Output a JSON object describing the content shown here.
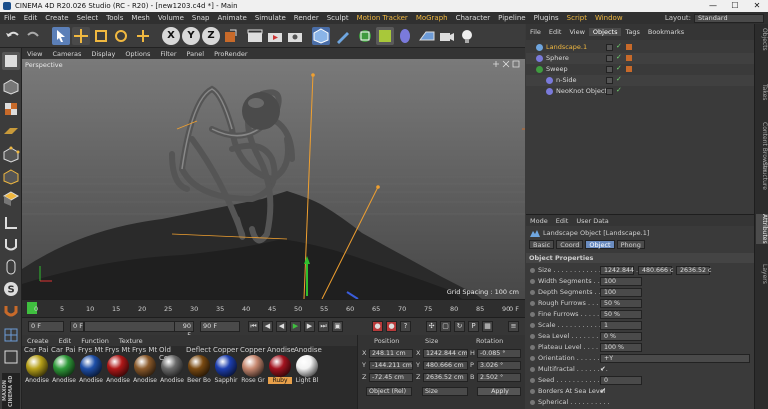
{
  "window": {
    "title": "CINEMA 4D R20.026 Studio (RC - R20) - [new1203.c4d *] - Main",
    "min": "—",
    "max": "☐",
    "close": "✕"
  },
  "menubar": {
    "items": [
      "File",
      "Edit",
      "Create",
      "Select",
      "Tools",
      "Mesh",
      "Volume",
      "Snap",
      "Animate",
      "Simulate",
      "Render",
      "Sculpt",
      "Motion Tracker",
      "MoGraph",
      "Character",
      "Pipeline",
      "Plugins",
      "Script",
      "Window"
    ],
    "layout_label": "Layout:",
    "layout_value": "Standard"
  },
  "toolbar": {
    "axis_x": "X",
    "axis_y": "Y",
    "axis_z": "Z"
  },
  "viewport": {
    "menu": [
      "View",
      "Cameras",
      "Display",
      "Options",
      "Filter",
      "Panel",
      "ProRender"
    ],
    "camera_label": "Perspective",
    "grid_spacing": "Grid Spacing : 100 cm"
  },
  "timeline": {
    "ticks": [
      "0",
      "5",
      "10",
      "15",
      "20",
      "25",
      "30",
      "35",
      "40",
      "45",
      "50",
      "55",
      "60",
      "65",
      "70",
      "75",
      "80",
      "85",
      "90"
    ],
    "end_label": "0 F"
  },
  "transport": {
    "current_frame": "0 F",
    "start_frame": "0 F",
    "end_frame": "90 F",
    "end_frame_right": "90 F"
  },
  "materials": {
    "menu": [
      "Create",
      "Edit",
      "Function",
      "Texture"
    ],
    "top_row": [
      "Car Pai",
      "Car Pai",
      "Frys Mt",
      "Frys Mt",
      "Frys Mt",
      "Old Cop",
      "Deflect",
      "Copper",
      "Copper",
      "Anodise",
      "Anodise"
    ],
    "items": [
      {
        "label": "Anodise",
        "color": "#b7a11a"
      },
      {
        "label": "Anodise",
        "color": "#2f9b3a"
      },
      {
        "label": "Anodise",
        "color": "#1e4fa8"
      },
      {
        "label": "Anodise",
        "color": "#b01818"
      },
      {
        "label": "Anodise",
        "color": "#8b5a2b"
      },
      {
        "label": "Anodise",
        "color": "#6a6a6a"
      },
      {
        "label": "Beer Bo",
        "color": "#7a4a12"
      },
      {
        "label": "Sapphir",
        "color": "#1d3fb0"
      },
      {
        "label": "Rose Gr",
        "color": "#c78870"
      },
      {
        "label": "Ruby",
        "color": "#a3131f",
        "selected": true
      },
      {
        "label": "Light Bl",
        "color": "#f2f2f2"
      }
    ]
  },
  "coords": {
    "headers": {
      "position": "Position",
      "size": "Size",
      "rotation": "Rotation"
    },
    "rows": [
      {
        "axis": "X",
        "pos": "248.11 cm",
        "size_axis": "X",
        "size": "1242.844 cm",
        "rot_axis": "H",
        "rot": "-0.085 °"
      },
      {
        "axis": "Y",
        "pos": "-144.211 cm",
        "size_axis": "Y",
        "size": "480.666 cm",
        "rot_axis": "P",
        "rot": "3.026 °"
      },
      {
        "axis": "Z",
        "pos": "-72.45 cm",
        "size_axis": "Z",
        "size": "2636.52 cm",
        "rot_axis": "B",
        "rot": "2.502 °"
      }
    ],
    "mode": "Object (Rel)",
    "size_mode": "Size",
    "apply": "Apply"
  },
  "objects": {
    "menu": [
      "File",
      "Edit",
      "View",
      "Objects",
      "Tags",
      "Bookmarks"
    ],
    "active_tab": "Objects",
    "items": [
      {
        "name": "Landscape.1",
        "indent": 0,
        "color": "#f0b840"
      },
      {
        "name": "Sphere",
        "indent": 0,
        "color": "#d8d8d8"
      },
      {
        "name": "Sweep",
        "indent": 0,
        "color": "#d8d8d8"
      },
      {
        "name": "n-Side",
        "indent": 1,
        "color": "#d8d8d8"
      },
      {
        "name": "NeoKnot Object",
        "indent": 1,
        "color": "#d8d8d8"
      }
    ]
  },
  "attributes": {
    "menu": [
      "Mode",
      "Edit",
      "User Data"
    ],
    "title": "Landscape Object [Landscape.1]",
    "tabs": [
      "Basic",
      "Coord",
      "Object",
      "Phong"
    ],
    "active_tab": "Object",
    "section": "Object Properties",
    "rows": [
      {
        "label": "Size . . . . . . . . . . . . . . . . . . . . .",
        "values": [
          "1242.844",
          "480.666 c",
          "2636.52 c"
        ]
      },
      {
        "label": "Width Segments . . . . .",
        "values": [
          "100"
        ]
      },
      {
        "label": "Depth Segments . . . . .",
        "values": [
          "100"
        ]
      },
      {
        "label": "Rough Furrows . . . . . .",
        "values": [
          "50 %"
        ]
      },
      {
        "label": "Fine Furrows . . . . . . .",
        "values": [
          "50 %"
        ]
      },
      {
        "label": "Scale . . . . . . . . . . . . .",
        "values": [
          "1"
        ]
      },
      {
        "label": "Sea Level . . . . . . . . . .",
        "values": [
          "0 %"
        ]
      },
      {
        "label": "Plateau Level . . . . . . .",
        "values": [
          "100 %"
        ]
      },
      {
        "label": "Orientation . . . . . . . . .",
        "values": [
          "+Y"
        ]
      },
      {
        "label": "Multifractal . . . . . . . .",
        "check": "✔"
      },
      {
        "label": "Seed . . . . . . . . . . . . . .",
        "values": [
          "0"
        ]
      },
      {
        "label": "Borders At Sea Level",
        "check": "✔"
      },
      {
        "label": "Spherical . . . . . . . . . .",
        "check": ""
      }
    ]
  },
  "righttabs": [
    "Objects",
    "Takes",
    "Content Browser",
    "Structure",
    "Attributes",
    "Layers"
  ]
}
